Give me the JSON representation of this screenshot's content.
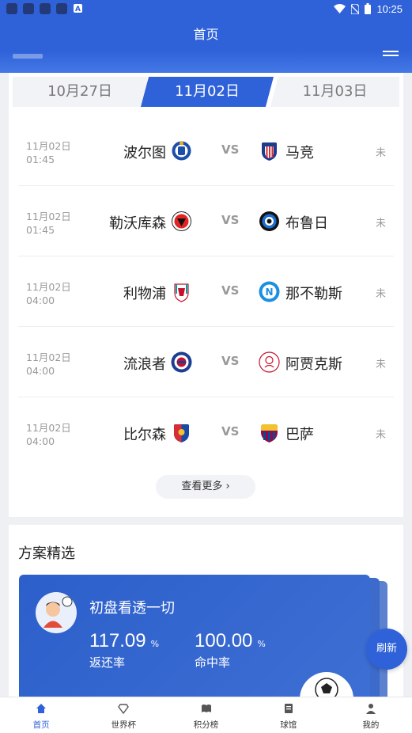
{
  "app": {
    "title": "首页"
  },
  "status_bar": {
    "time": "10:25"
  },
  "date_tabs": [
    "10月27日",
    "11月02日",
    "11月03日"
  ],
  "matches": [
    {
      "date": "11月02日",
      "time": "01:45",
      "home": "波尔图",
      "away": "马竞",
      "vs": "VS",
      "status": "未"
    },
    {
      "date": "11月02日",
      "time": "01:45",
      "home": "勒沃库森",
      "away": "布鲁日",
      "vs": "VS",
      "status": "未"
    },
    {
      "date": "11月02日",
      "time": "04:00",
      "home": "利物浦",
      "away": "那不勒斯",
      "vs": "VS",
      "status": "未"
    },
    {
      "date": "11月02日",
      "time": "04:00",
      "home": "流浪者",
      "away": "阿贾克斯",
      "vs": "VS",
      "status": "未"
    },
    {
      "date": "11月02日",
      "time": "04:00",
      "home": "比尔森",
      "away": "巴萨",
      "vs": "VS",
      "status": "未"
    }
  ],
  "more_label": "查看更多",
  "plans": {
    "title": "方案精选",
    "card": {
      "name": "初盘看透一切",
      "return_value": "117.09",
      "return_unit": "%",
      "return_label": "返还率",
      "hit_value": "100.00",
      "hit_unit": "%",
      "hit_label": "命中率"
    }
  },
  "refresh_label": "刷新",
  "bottom_nav": [
    "首页",
    "世界杯",
    "积分榜",
    "球馆",
    "我的"
  ],
  "colors": {
    "primary": "#2f62d8",
    "card_bg": "#ffffff",
    "page_bg": "#eef0f4"
  }
}
